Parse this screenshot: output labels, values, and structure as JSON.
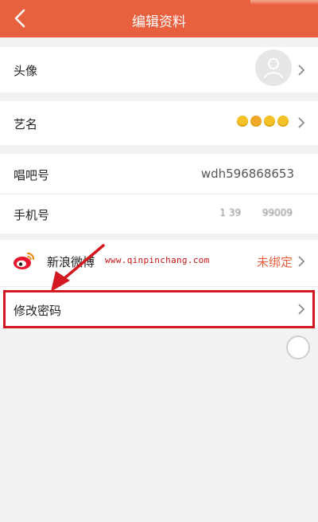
{
  "header": {
    "title": "编辑资料",
    "back_icon": "back-chevron-icon",
    "background": "#e9603f"
  },
  "rows": {
    "avatar": {
      "label": "头像",
      "icon": "avatar-placeholder-icon"
    },
    "stage_name": {
      "label": "艺名",
      "value_icons": "emoji-icons"
    },
    "changba_id": {
      "label": "唱吧号",
      "value": "wdh596868653"
    },
    "phone": {
      "label": "手机号",
      "value": "1 39       99009"
    },
    "weibo": {
      "label": "新浪微博",
      "value": "未绑定",
      "icon": "weibo-icon",
      "value_color": "#e9603f"
    },
    "change_password": {
      "label": "修改密码"
    }
  },
  "watermark": {
    "text": "www.qinpinchang.com",
    "color": "#c81414"
  },
  "annotation": {
    "arrow_color": "#d3191f",
    "box_color": "#d3191f"
  }
}
